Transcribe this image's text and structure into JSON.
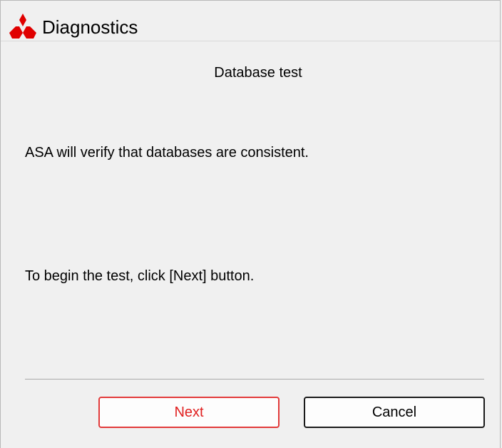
{
  "window": {
    "title": "Diagnostics",
    "logo_icon": "mitsubishi-logo-icon",
    "logo_color": "#e00000"
  },
  "content": {
    "heading": "Database test",
    "message": "ASA will verify that databases are consistent.",
    "instruction": "To begin the test, click [Next] button."
  },
  "buttons": {
    "next_label": "Next",
    "cancel_label": "Cancel",
    "next_color": "#e02020"
  }
}
